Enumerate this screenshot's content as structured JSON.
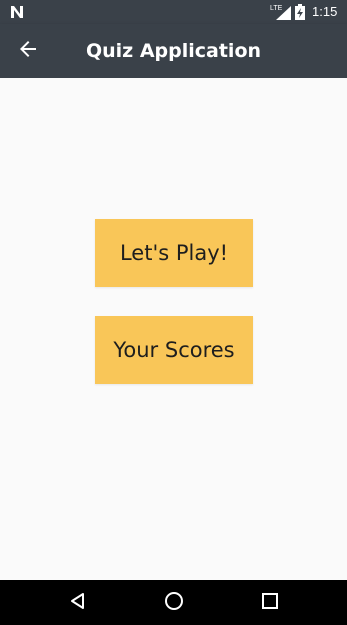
{
  "status_bar": {
    "time": "1:15",
    "network_label": "LTE",
    "icons": [
      "n-notification-icon",
      "lte-signal-icon",
      "battery-charging-icon"
    ]
  },
  "app_bar": {
    "title": "Quiz Application",
    "back_icon": "arrow-left-icon"
  },
  "menu": {
    "play_label": "Let's Play!",
    "scores_label": "Your Scores"
  },
  "nav_bar": {
    "icons": [
      "triangle-back-icon",
      "circle-home-icon",
      "square-recents-icon"
    ]
  },
  "colors": {
    "app_bar": "#3A4149",
    "button": "#F9C658",
    "background": "#FAFAFA",
    "nav_bar": "#000000"
  }
}
